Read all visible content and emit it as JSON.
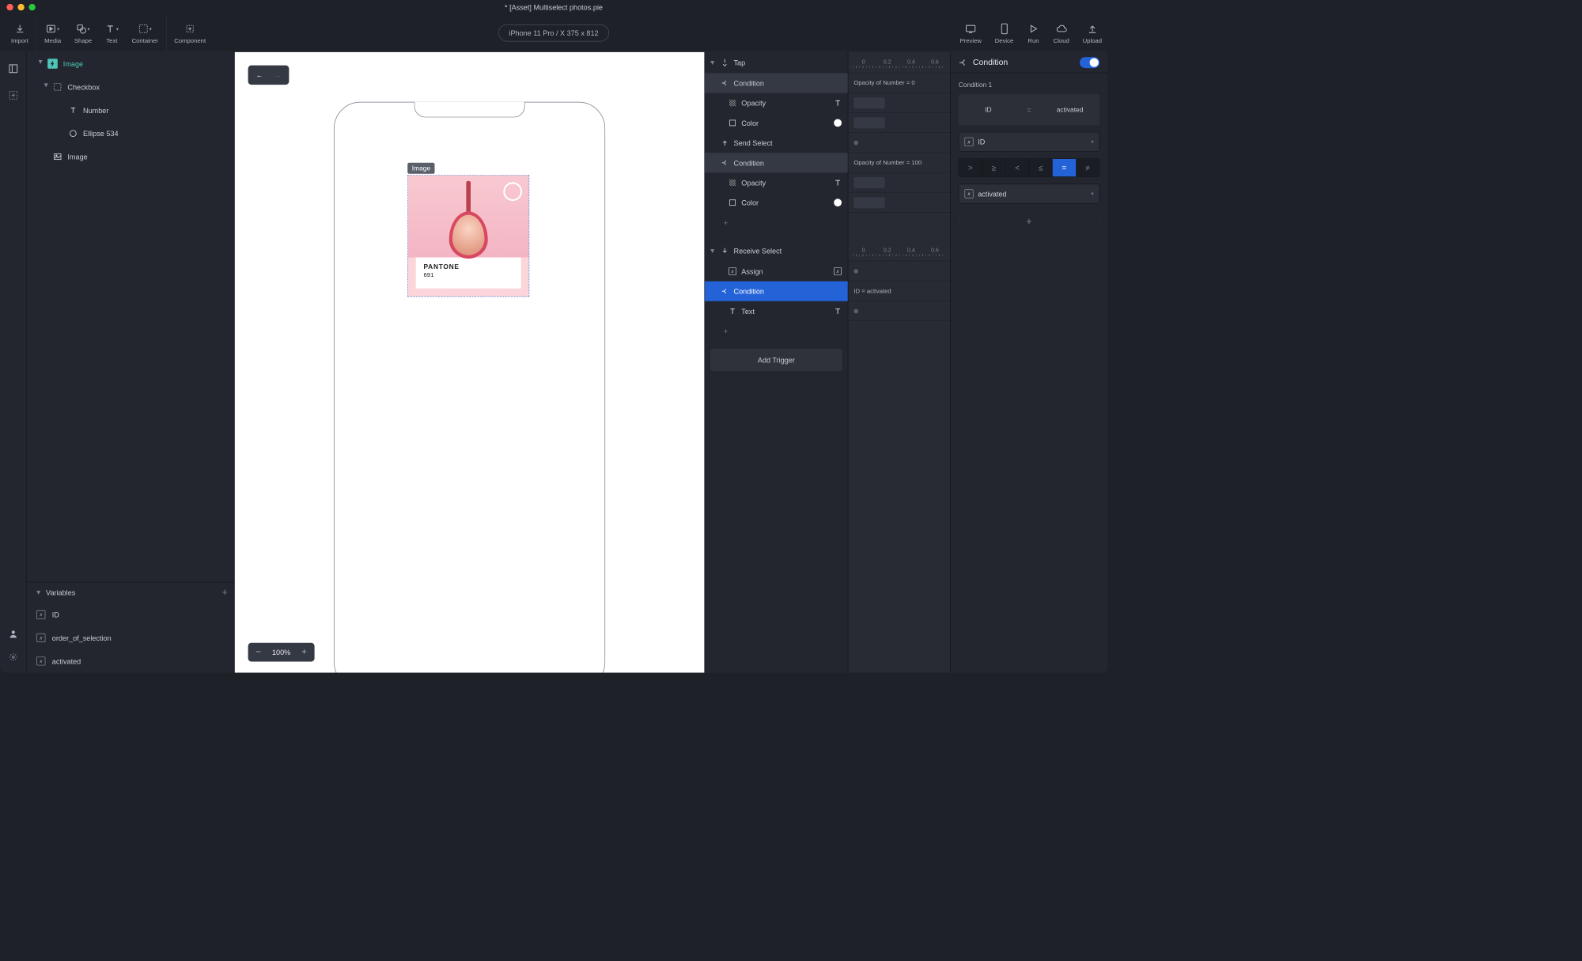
{
  "title": "* [Asset] Multiselect photos.pie",
  "device_pill": "iPhone 11 Pro / X  375 x 812",
  "toolbar": {
    "import": "Import",
    "media": "Media",
    "shape": "Shape",
    "text": "Text",
    "container": "Container",
    "component": "Component",
    "preview": "Preview",
    "device": "Device",
    "run": "Run",
    "cloud": "Cloud",
    "upload": "Upload"
  },
  "tree": {
    "root": "Image",
    "checkbox": "Checkbox",
    "number": "Number",
    "ellipse": "Ellipse 534",
    "image": "Image"
  },
  "variables": {
    "header": "Variables",
    "id": "ID",
    "order": "order_of_selection",
    "activated": "activated"
  },
  "canvas": {
    "img_label": "Image",
    "zoom": "100%",
    "card_title": "PANTONE",
    "card_sub": "691"
  },
  "triggers": {
    "tap": "Tap",
    "condition": "Condition",
    "opacity": "Opacity",
    "color": "Color",
    "send": "Send Select",
    "receive": "Receive Select",
    "assign": "Assign",
    "text": "Text",
    "add_trigger": "Add Trigger"
  },
  "midright": {
    "ruler": [
      "0",
      "0.2",
      "0.4",
      "0.6"
    ],
    "op0": "Opacity of Number = 0",
    "op100": "Opacity of Number = 100",
    "id_act": "ID = activated"
  },
  "cond": {
    "header": "Condition",
    "sub": "Condition 1",
    "left": "ID",
    "right": "activated",
    "sel1": "ID",
    "sel2": "activated",
    "ops": [
      ">",
      "≥",
      "<",
      "≤",
      "=",
      "≠"
    ]
  }
}
